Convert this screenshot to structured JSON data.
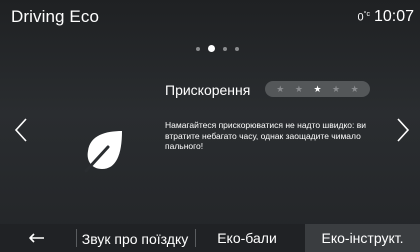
{
  "header": {
    "title": "Driving Eco",
    "temperature": "0",
    "temperature_unit": "°c",
    "time": "10:07"
  },
  "pager": {
    "count": 4,
    "active": 1
  },
  "card": {
    "title": "Прискорення",
    "rating": 3,
    "rating_max": 5,
    "message": "Намагайтеся прискорюватися не надто швидко: ви втратите небагато часу, однак заощадите чимало пального!"
  },
  "bottom": {
    "tabs": [
      {
        "label": "Звук про поїздку"
      },
      {
        "label": "Еко-бали"
      },
      {
        "label": "Еко-інструкт."
      }
    ],
    "selected_tab": 2
  },
  "icons": {
    "back": "back-arrow-icon",
    "prev": "chevron-left-icon",
    "next": "chevron-right-icon",
    "leaf": "leaf-icon"
  }
}
